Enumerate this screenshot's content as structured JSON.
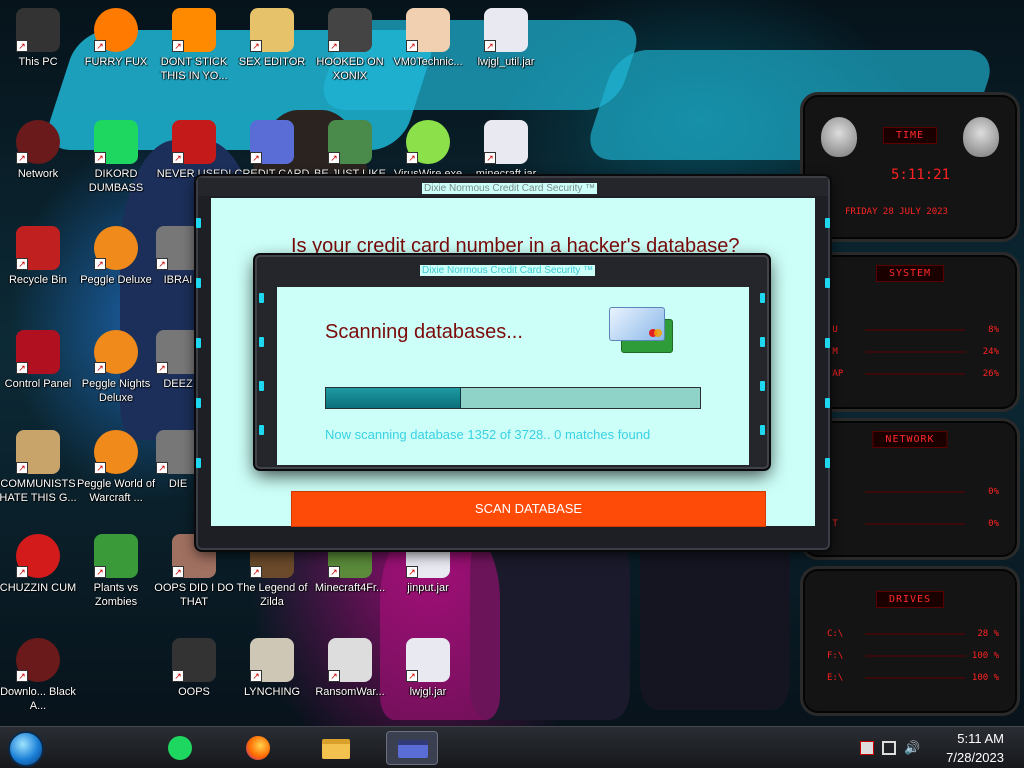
{
  "desktop_icons": [
    {
      "id": "this-pc",
      "label": "This PC",
      "icon": "computer-icon"
    },
    {
      "id": "furry-fux",
      "label": "FURRY FUX",
      "icon": "firefox-icon"
    },
    {
      "id": "dont-stick",
      "label": "DONT STICK THIS IN YO...",
      "icon": "vlc-icon"
    },
    {
      "id": "sex-editor",
      "label": "SEX EDITOR",
      "icon": "hxd-icon"
    },
    {
      "id": "hooked",
      "label": "HOOKED ON XONIX",
      "icon": "xonix-icon"
    },
    {
      "id": "vm0",
      "label": "VM0Technic...",
      "icon": "doctor-icon"
    },
    {
      "id": "lwjgl-util",
      "label": "lwjgl_util.jar",
      "icon": "java-icon"
    },
    {
      "id": "network",
      "label": "Network",
      "icon": "alien-icon"
    },
    {
      "id": "dikord",
      "label": "DIKORD DUMBASS",
      "icon": "chat-icon"
    },
    {
      "id": "never-used",
      "label": "NEVER USED!",
      "icon": "devcpp-icon"
    },
    {
      "id": "credit-card",
      "label": "CREDIT CARD",
      "icon": "credit-card-icon"
    },
    {
      "id": "be-just-like",
      "label": "BE JUST LIKE",
      "icon": "santa-icon"
    },
    {
      "id": "viruswire",
      "label": "VirusWire.exe",
      "icon": "lime-icon"
    },
    {
      "id": "minecraft-jar",
      "label": "minecraft.jar",
      "icon": "java-icon"
    },
    {
      "id": "recycle-bin",
      "label": "Recycle Bin",
      "icon": "recycle-bin-icon"
    },
    {
      "id": "peggle-deluxe",
      "label": "Peggle Deluxe",
      "icon": "peggle-icon"
    },
    {
      "id": "ibrai",
      "label": "IBRAI",
      "icon": "generic-icon"
    },
    {
      "id": "control-panel",
      "label": "Control Panel",
      "icon": "control-panel-icon"
    },
    {
      "id": "peggle-nights",
      "label": "Peggle Nights Deluxe",
      "icon": "peggle-icon"
    },
    {
      "id": "deez",
      "label": "DEEZ",
      "icon": "generic-icon"
    },
    {
      "id": "communists",
      "label": "COMMUNISTS HATE THIS G...",
      "icon": "money-bag-icon"
    },
    {
      "id": "peggle-world",
      "label": "Peggle World of Warcraft ...",
      "icon": "peggle-icon"
    },
    {
      "id": "die",
      "label": "DIE",
      "icon": "generic-icon"
    },
    {
      "id": "chuzzin",
      "label": "CHUZZIN CUM",
      "icon": "chuzzle-icon"
    },
    {
      "id": "pvz",
      "label": "Plants vs Zombies",
      "icon": "plant-icon"
    },
    {
      "id": "oops-did",
      "label": "OOPS DID I DO THAT",
      "icon": "portrait-icon"
    },
    {
      "id": "zilda",
      "label": "The Legend of Zilda",
      "icon": "zelda-icon"
    },
    {
      "id": "minecraft4fr",
      "label": "Minecraft4Fr...",
      "icon": "minecraft-icon"
    },
    {
      "id": "jinput",
      "label": "jinput.jar",
      "icon": "java-icon"
    },
    {
      "id": "download",
      "label": "Downlo... Black A...",
      "icon": "alien-icon"
    },
    {
      "id": "oops",
      "label": "OOPS",
      "icon": "tablet-icon"
    },
    {
      "id": "lynching",
      "label": "LYNCHING",
      "icon": "rope-icon"
    },
    {
      "id": "ransomwar",
      "label": "RansomWar...",
      "icon": "skull-icon"
    },
    {
      "id": "lwjgl-jar",
      "label": "lwjgl.jar",
      "icon": "java-icon"
    }
  ],
  "gadgets": {
    "time": {
      "heading": "TIME",
      "time": "5:11:21",
      "date": "FRIDAY 28 JULY 2023"
    },
    "system": {
      "heading": "SYSTEM",
      "rows": [
        {
          "label": "PU",
          "value": "8%"
        },
        {
          "label": "AM",
          "value": "24%"
        },
        {
          "label": "WAP",
          "value": "26%"
        }
      ]
    },
    "network": {
      "heading": "NETWORK",
      "rows": [
        {
          "label": "",
          "value": "0%"
        },
        {
          "label": "UT",
          "value": "0%"
        }
      ]
    },
    "drives": {
      "heading": "DRIVES",
      "rows": [
        {
          "label": "C:\\",
          "value": "28 %"
        },
        {
          "label": "F:\\",
          "value": "100 %"
        },
        {
          "label": "E:\\",
          "value": "100 %"
        }
      ]
    }
  },
  "outer_window": {
    "title": "Dixie Normous Credit Card Security ™",
    "heading": "Is your credit card number in a hacker's database?",
    "scan_button": "SCAN DATABASE"
  },
  "inner_window": {
    "title": "Dixie Normous Credit Card Security ™",
    "heading": "Scanning databases...",
    "progress": 0.36,
    "status": "Now scanning database 1352 of 3728.. 0 matches found"
  },
  "taskbar": {
    "apps": [
      {
        "id": "spotify",
        "icon": "spotify-icon",
        "active": false
      },
      {
        "id": "firefox",
        "icon": "firefox-icon",
        "active": false
      },
      {
        "id": "explorer",
        "icon": "folder-icon",
        "active": false
      },
      {
        "id": "creditcard",
        "icon": "credit-card-icon",
        "active": true
      }
    ],
    "clock": {
      "time": "5:11 AM",
      "date": "7/28/2023"
    }
  },
  "colors": {
    "window_client": "#ccfff8",
    "heading": "#7b0a0a",
    "button": "#ff4b08",
    "status": "#39d2e3",
    "progress_fill": "#0b6f78",
    "gadget_text": "#ff2222"
  }
}
